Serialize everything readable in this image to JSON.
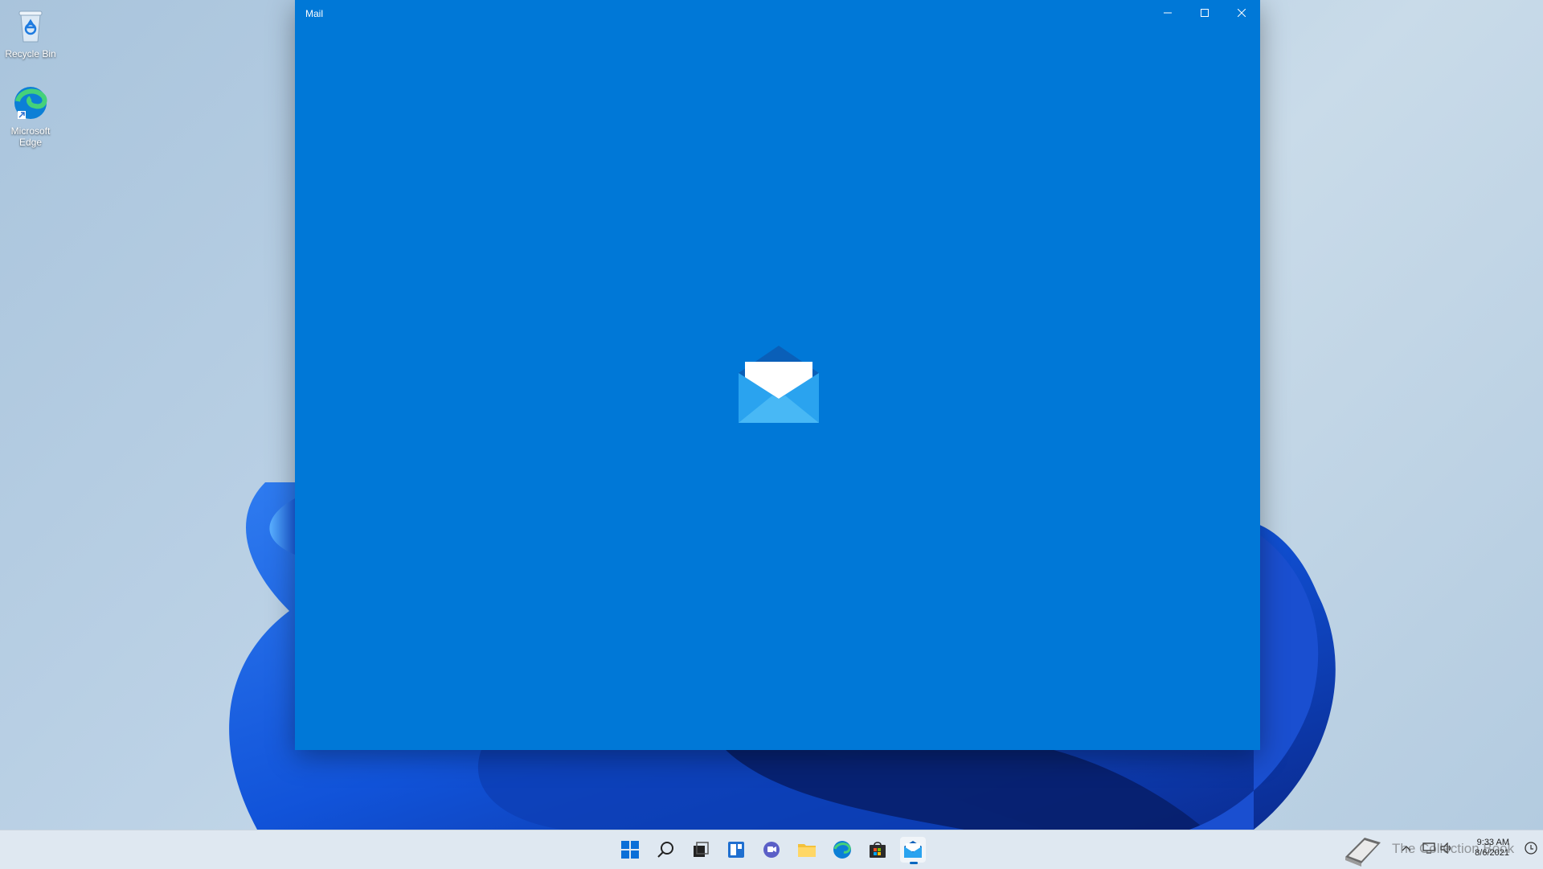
{
  "desktop": {
    "icons": [
      {
        "label": "Recycle Bin",
        "icon": "recycle-bin-icon"
      },
      {
        "label": "Microsoft Edge",
        "icon": "edge-icon"
      }
    ]
  },
  "window": {
    "title": "Mail",
    "background": "#0078d7",
    "controls": [
      "minimize-icon",
      "maximize-icon",
      "close-icon"
    ],
    "splash_icon": "mail-envelope-icon"
  },
  "taskbar": {
    "items": [
      "start-icon",
      "search-icon",
      "task-view-icon",
      "widgets-icon",
      "chat-icon",
      "file-explorer-icon",
      "edge-icon",
      "store-icon",
      "mail-icon"
    ],
    "active_item": "mail-icon",
    "tray": {
      "time": "9:33 AM",
      "date": "8/6/2021",
      "watermark": "The Collection Book"
    }
  },
  "colors": {
    "accent": "#0078d7",
    "taskbar": "#dfe8f1"
  }
}
